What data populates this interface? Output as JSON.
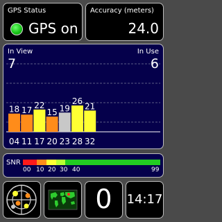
{
  "status": {
    "label": "GPS Status",
    "value": "GPS on",
    "indicator_color": "#18c418"
  },
  "accuracy": {
    "label": "Accuracy (meters)",
    "value": "24.0"
  },
  "satellites": {
    "in_view_label": "In View",
    "in_view": "7",
    "in_use_label": "In Use",
    "in_use": "6",
    "bars": [
      {
        "id": "04",
        "snr": 18,
        "label": "18",
        "color": "#ff8c1a"
      },
      {
        "id": "11",
        "snr": 17,
        "label": "17",
        "color": "#ff8c1a"
      },
      {
        "id": "17",
        "snr": 22,
        "label": "22",
        "color": "#ffff33"
      },
      {
        "id": "20",
        "snr": 15,
        "label": "15",
        "color": "#ff8c1a"
      },
      {
        "id": "23",
        "snr": 19,
        "label": "19",
        "color": "#c8c8c8"
      },
      {
        "id": "28",
        "snr": 26,
        "label": "26",
        "color": "#ffff33"
      },
      {
        "id": "32",
        "snr": 21,
        "label": "21",
        "color": "#ffff33"
      }
    ]
  },
  "snr_legend": {
    "label": "SNR",
    "ticks": [
      "00",
      "10",
      "20",
      "30",
      "40",
      "99"
    ],
    "segments": [
      {
        "color": "#ff1a1a",
        "weight": 10
      },
      {
        "color": "#ff8c1a",
        "weight": 7
      },
      {
        "color": "#ffff33",
        "weight": 7
      },
      {
        "color": "#b8ff33",
        "weight": 7
      },
      {
        "color": "#22cc22",
        "weight": 69
      }
    ]
  },
  "bottom": {
    "radar_icon": "sky-radar-icon",
    "map_icon": "world-map-icon",
    "count": "0",
    "time": "14:17"
  }
}
